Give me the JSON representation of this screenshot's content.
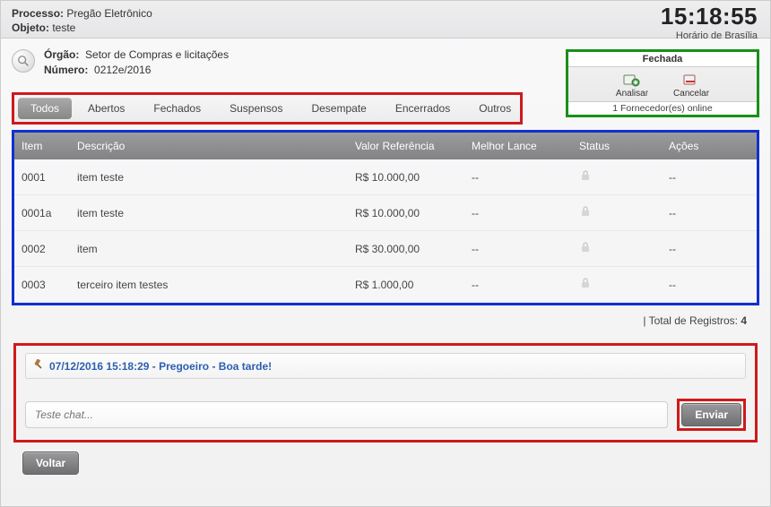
{
  "header": {
    "processo_label": "Processo:",
    "processo_value": "Pregão Eletrônico",
    "objeto_label": "Objeto:",
    "objeto_value": "teste",
    "clock_time": "15:18:55",
    "clock_tz": "Horário de Brasília"
  },
  "org": {
    "orgao_label": "Órgão:",
    "orgao_value": "Setor de Compras e licitações",
    "numero_label": "Número:",
    "numero_value": "0212e/2016"
  },
  "status_box": {
    "title": "Fechada",
    "analisar": "Analisar",
    "cancelar": "Cancelar",
    "footer": "1 Fornecedor(es) online"
  },
  "tabs": {
    "todos": "Todos",
    "abertos": "Abertos",
    "fechados": "Fechados",
    "suspensos": "Suspensos",
    "desempate": "Desempate",
    "encerrados": "Encerrados",
    "outros": "Outros"
  },
  "table": {
    "headers": {
      "item": "Item",
      "descricao": "Descrição",
      "valor": "Valor Referência",
      "melhor": "Melhor Lance",
      "status": "Status",
      "acoes": "Ações"
    },
    "rows": [
      {
        "item": "0001",
        "desc": "item teste",
        "valor": "R$ 10.000,00",
        "melhor": "--",
        "acoes": "--"
      },
      {
        "item": "0001a",
        "desc": "item teste",
        "valor": "R$ 10.000,00",
        "melhor": "--",
        "acoes": "--"
      },
      {
        "item": "0002",
        "desc": "item",
        "valor": "R$ 30.000,00",
        "melhor": "--",
        "acoes": "--"
      },
      {
        "item": "0003",
        "desc": "terceiro item testes",
        "valor": "R$ 1.000,00",
        "melhor": "--",
        "acoes": "--"
      }
    ],
    "total_label": "| Total de Registros:",
    "total_value": "4"
  },
  "chat": {
    "log_text": "07/12/2016 15:18:29 - Pregoeiro - Boa tarde!",
    "input_placeholder": "Teste chat...",
    "send_label": "Enviar"
  },
  "footer": {
    "voltar": "Voltar"
  }
}
